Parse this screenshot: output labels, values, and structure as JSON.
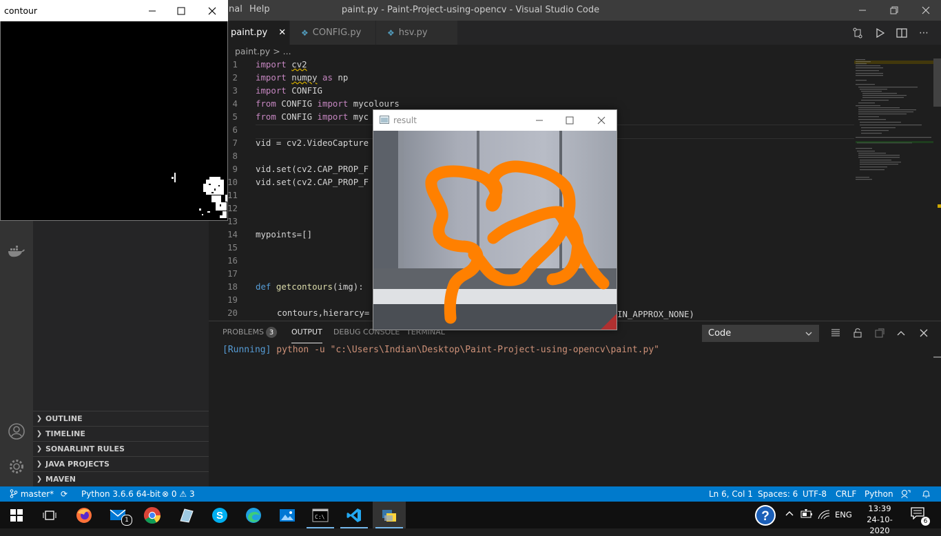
{
  "vscode": {
    "menu_partial": "nal",
    "menu_help": "Help",
    "window_title": "paint.py - Paint-Project-using-opencv - Visual Studio Code",
    "tabs": [
      {
        "label": "paint.py",
        "active": true,
        "close": "✕"
      },
      {
        "label": "CONFIG.py",
        "active": false
      },
      {
        "label": "hsv.py",
        "active": false
      }
    ],
    "breadcrumb": {
      "file": "paint.py",
      "sep": ">",
      "rest": "..."
    },
    "editor_lines": [
      {
        "n": "1",
        "text": "import cv2"
      },
      {
        "n": "2",
        "text": "import numpy as np"
      },
      {
        "n": "3",
        "text": "import CONFIG"
      },
      {
        "n": "4",
        "text": "from CONFIG import mycolours"
      },
      {
        "n": "5",
        "text": "from CONFIG import myc"
      },
      {
        "n": "6",
        "text": ""
      },
      {
        "n": "7",
        "text": "vid = cv2.VideoCapture"
      },
      {
        "n": "8",
        "text": ""
      },
      {
        "n": "9",
        "text": "vid.set(cv2.CAP_PROP_F"
      },
      {
        "n": "10",
        "text": "vid.set(cv2.CAP_PROP_F"
      },
      {
        "n": "11",
        "text": ""
      },
      {
        "n": "12",
        "text": ""
      },
      {
        "n": "13",
        "text": ""
      },
      {
        "n": "14",
        "text": "mypoints=[]"
      },
      {
        "n": "15",
        "text": ""
      },
      {
        "n": "16",
        "text": ""
      },
      {
        "n": "17",
        "text": ""
      },
      {
        "n": "18",
        "text": "def getcontours(img):"
      },
      {
        "n": "19",
        "text": ""
      },
      {
        "n": "20",
        "text": "contours,hierarcy="
      }
    ],
    "line20_tail": "IN_APPROX_NONE)",
    "sidebar_sections": [
      "OUTLINE",
      "TIMELINE",
      "SONARLINT RULES",
      "JAVA PROJECTS",
      "MAVEN"
    ],
    "panel": {
      "tabs": [
        "PROBLEMS",
        "OUTPUT",
        "DEBUG CONSOLE",
        "TERMINAL"
      ],
      "problems_count": "3",
      "active_tab": "OUTPUT",
      "output_channel": "Code",
      "running_label": "[Running]",
      "output_cmd": "python -u \"c:\\Users\\Indian\\Desktop\\Paint-Project-using-opencv\\paint.py\""
    },
    "statusbar": {
      "branch": "master*",
      "interpreter": "Python 3.6.6 64-bit",
      "errors": "0",
      "warnings": "3",
      "position": "Ln 6, Col 1",
      "spaces": "Spaces: 6",
      "encoding": "UTF-8",
      "eol": "CRLF",
      "language": "Python"
    }
  },
  "contour_window": {
    "title": "contour"
  },
  "result_window": {
    "title": "result"
  },
  "taskbar": {
    "mail_badge": "1",
    "lang": "ENG",
    "time": "13:39",
    "date": "24-10-2020",
    "notification_count": "6"
  },
  "colors": {
    "statusbar": "#007acc",
    "stroke_orange": "#ff8000",
    "keyword": "#c586c0",
    "output_running": "#569cd6",
    "output_string": "#ce9178"
  }
}
